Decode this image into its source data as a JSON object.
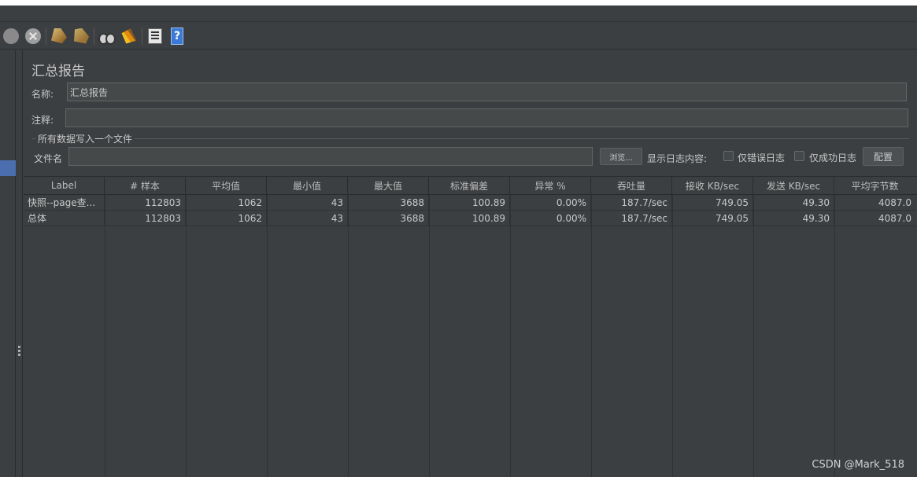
{
  "toolbar": {
    "icons": [
      "stop-icon",
      "shutdown-icon",
      "clear-icon",
      "clear-all-icon",
      "search-icon",
      "reset-search-icon",
      "function-helper-icon",
      "help-icon"
    ],
    "help_glyph": "?"
  },
  "panel": {
    "title": "汇总报告",
    "name_label": "名称:",
    "name_value": "汇总报告",
    "comment_label": "注释:",
    "comment_value": "",
    "group_title": "所有数据写入一个文件",
    "filename_label": "文件名",
    "filename_value": "",
    "browse_button": "浏览...",
    "log_content_label": "显示日志内容:",
    "errors_only_label": "仅错误日志",
    "success_only_label": "仅成功日志",
    "configure_button": "配置"
  },
  "table": {
    "headers": [
      "Label",
      "# 样本",
      "平均值",
      "最小值",
      "最大值",
      "标准偏差",
      "异常 %",
      "吞吐量",
      "接收 KB/sec",
      "发送 KB/sec",
      "平均字节数"
    ],
    "rows": [
      [
        "快照--page查...",
        "112803",
        "1062",
        "43",
        "3688",
        "100.89",
        "0.00%",
        "187.7/sec",
        "749.05",
        "49.30",
        "4087.0"
      ],
      [
        "总体",
        "112803",
        "1062",
        "43",
        "3688",
        "100.89",
        "0.00%",
        "187.7/sec",
        "749.05",
        "49.30",
        "4087.0"
      ]
    ]
  },
  "watermark": "CSDN @Mark_518"
}
